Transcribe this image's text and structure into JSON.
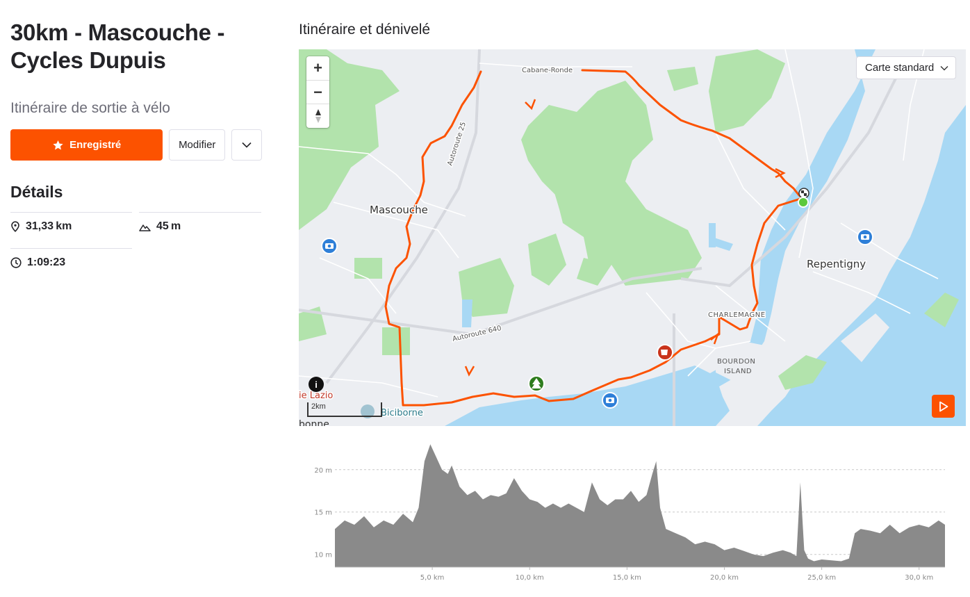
{
  "header": {
    "title": "30km - Mascouche - Cycles Dupuis",
    "subtitle": "Itinéraire de sortie à vélo"
  },
  "actions": {
    "saved_label": "Enregistré",
    "modify_label": "Modifier"
  },
  "details": {
    "heading": "Détails",
    "distance": "31,33 km",
    "elevation": "45 m",
    "moving_time": "1:09:23"
  },
  "map": {
    "section_title": "Itinéraire et dénivelé",
    "layer_select": "Carte standard",
    "scale_label": "2km",
    "labels": {
      "cabane_ronde": "Cabane-Ronde",
      "mascouche": "Mascouche",
      "autoroute_25": "Autoroute 25",
      "autoroute_640": "Autoroute 640",
      "repentigny": "Repentigny",
      "charlemagne": "CHARLEMAGNE",
      "bourdon": "BOURDON",
      "island": "ISLAND",
      "lazio": "ie Lazio",
      "biciborne": "Biciborne",
      "bonne": "bonne"
    },
    "colors": {
      "route": "#fc5200",
      "water": "#a8d8f4",
      "park": "#b2e3ac",
      "land": "#eceef2"
    }
  },
  "chart_data": {
    "type": "area",
    "title": "",
    "xlabel": "",
    "ylabel": "",
    "x_unit": "km",
    "y_unit": "m",
    "xlim": [
      0,
      31.33
    ],
    "ylim": [
      8.5,
      24
    ],
    "x_ticks": [
      "5,0 km",
      "10,0 km",
      "15,0 km",
      "20,0 km",
      "25,0 km",
      "30,0 km"
    ],
    "x_tick_values": [
      5,
      10,
      15,
      20,
      25,
      30
    ],
    "y_ticks": [
      "20 m",
      "15 m",
      "10 m"
    ],
    "y_tick_values": [
      20,
      15,
      10
    ],
    "grid": true,
    "color": "#8a8a8a",
    "series": [
      {
        "x": [
          0,
          0.5,
          1,
          1.5,
          2,
          2.5,
          3,
          3.5,
          4,
          4.3,
          4.6,
          4.9,
          5.2,
          5.5,
          5.8,
          6,
          6.4,
          6.8,
          7.2,
          7.6,
          8,
          8.4,
          8.8,
          9.2,
          9.6,
          10,
          10.4,
          10.8,
          11.2,
          11.6,
          12,
          12.4,
          12.8,
          13.2,
          13.6,
          14,
          14.4,
          14.8,
          15.2,
          15.6,
          16,
          16.3,
          16.5,
          16.7,
          17,
          17.5,
          18,
          18.5,
          19,
          19.5,
          20,
          20.5,
          21,
          21.5,
          22,
          22.5,
          23,
          23.4,
          23.7,
          23.9,
          24.1,
          24.3,
          24.6,
          25,
          25.5,
          26,
          26.4,
          26.7,
          27,
          27.5,
          28,
          28.5,
          29,
          29.5,
          30,
          30.5,
          31,
          31.33
        ],
        "y": [
          13,
          14,
          13.5,
          14.5,
          13.2,
          14,
          13.5,
          14.8,
          13.8,
          15.5,
          21,
          23,
          21.5,
          20,
          19.5,
          20.5,
          18,
          17,
          17.5,
          16.5,
          17,
          16.8,
          17.2,
          19,
          17.5,
          16.5,
          16.2,
          15.5,
          16,
          15.5,
          16,
          15.5,
          15,
          18.5,
          16.5,
          15.8,
          16.5,
          16.5,
          17.5,
          16.2,
          17,
          19.5,
          21,
          15.5,
          13,
          12.5,
          12,
          11.2,
          11.5,
          11.2,
          10.5,
          10.8,
          10.4,
          10,
          9.8,
          10.2,
          10.5,
          10.2,
          9.8,
          18.5,
          10.5,
          9.5,
          9.2,
          9.4,
          9.3,
          9.2,
          9.5,
          12.5,
          13,
          12.8,
          12.5,
          13.5,
          12.5,
          13.2,
          13.5,
          13.2,
          14,
          13.5
        ]
      }
    ]
  }
}
